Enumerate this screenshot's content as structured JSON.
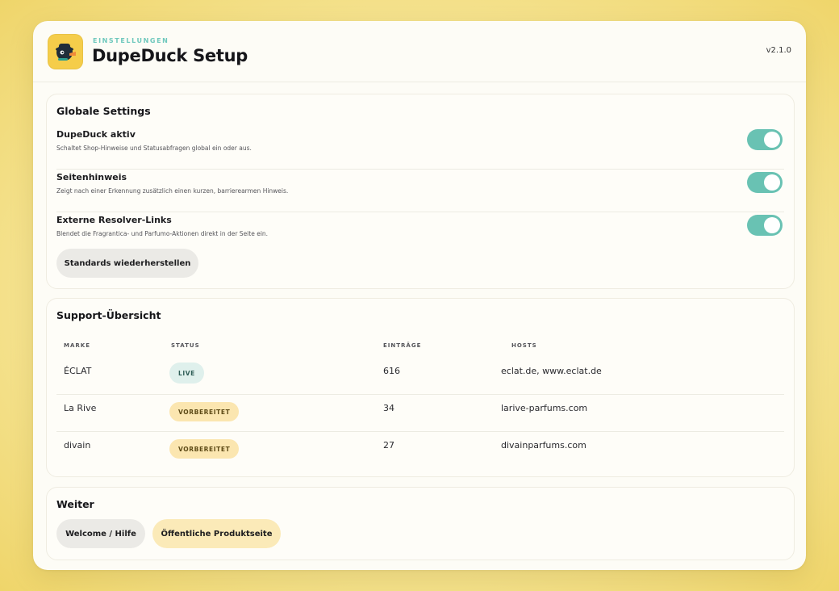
{
  "header": {
    "eyebrow": "EINSTELLUNGEN",
    "title": "DupeDuck Setup",
    "version": "v2.1.0"
  },
  "global_settings": {
    "title": "Globale Settings",
    "items": [
      {
        "label": "DupeDuck aktiv",
        "description": "Schaltet Shop-Hinweise und Statusabfragen global ein oder aus.",
        "enabled": true
      },
      {
        "label": "Seitenhinweis",
        "description": "Zeigt nach einer Erkennung zusätzlich einen kurzen, barrierearmen Hinweis.",
        "enabled": true
      },
      {
        "label": "Externe Resolver-Links",
        "description": "Blendet die Fragrantica- und Parfumo-Aktionen direkt in der Seite ein.",
        "enabled": true
      }
    ],
    "reset_label": "Standards wiederherstellen"
  },
  "support": {
    "title": "Support-Übersicht",
    "columns": [
      "MARKE",
      "STATUS",
      "EINTRÄGE",
      "HOSTS"
    ],
    "rows": [
      {
        "brand": "ÉCLAT",
        "status": "LIVE",
        "entries": "616",
        "hosts": "eclat.de, www.eclat.de"
      },
      {
        "brand": "La Rive",
        "status": "VORBEREITET",
        "entries": "34",
        "hosts": "larive-parfums.com"
      },
      {
        "brand": "divain",
        "status": "VORBEREITET",
        "entries": "27",
        "hosts": "divainparfums.com"
      }
    ]
  },
  "more": {
    "title": "Weiter",
    "welcome_label": "Welcome / Hilfe",
    "product_page_label": "Öffentliche Produktseite"
  },
  "colors": {
    "accent": "#69c2b3",
    "eyebrow": "#6fc8bd",
    "logo_bg": "#f5cd4a",
    "badge_live_bg": "#dff0ec",
    "badge_prep_bg": "#fbe6b0",
    "button_yellow_bg": "#fbeab8"
  },
  "icons": {
    "logo": "duck-logo-icon"
  }
}
